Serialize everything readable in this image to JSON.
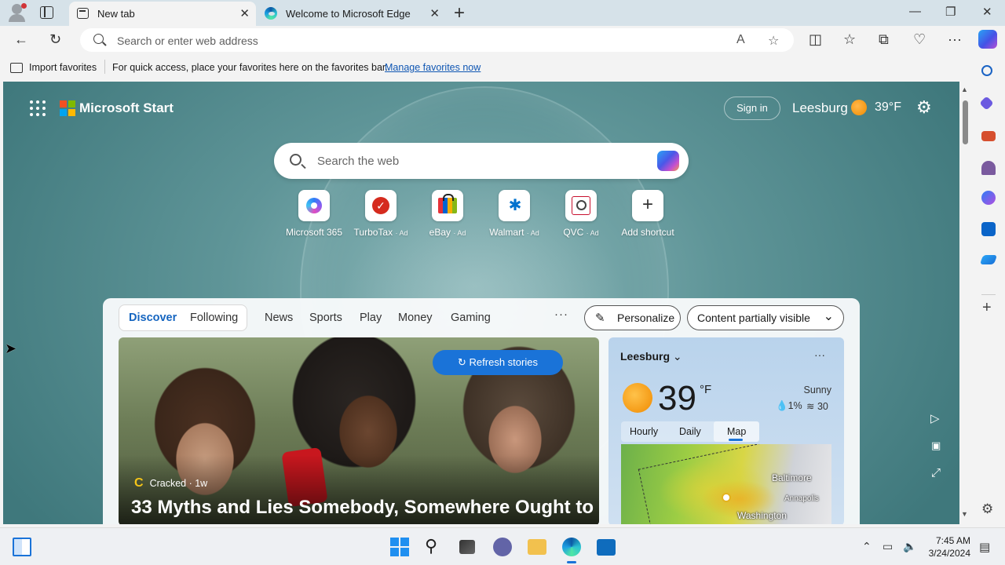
{
  "tabs": [
    {
      "label": "New tab",
      "active": true
    },
    {
      "label": "Welcome to Microsoft Edge",
      "active": false
    }
  ],
  "address": {
    "placeholder": "Search or enter web address"
  },
  "favorites": {
    "import_label": "Import favorites",
    "hint": "For quick access, place your favorites here on the favorites bar.",
    "manage_link": "Manage favorites now"
  },
  "header": {
    "brand": "Microsoft Start",
    "sign_in": "Sign in",
    "city": "Leesburg",
    "temp": "39°F"
  },
  "search": {
    "placeholder": "Search the web"
  },
  "shortcuts": [
    {
      "label": "Microsoft 365",
      "ad": ""
    },
    {
      "label": "TurboTax",
      "ad": "· Ad"
    },
    {
      "label": "eBay",
      "ad": "· Ad"
    },
    {
      "label": "Walmart",
      "ad": "· Ad"
    },
    {
      "label": "QVC",
      "ad": "· Ad"
    },
    {
      "label": "Add shortcut",
      "ad": ""
    }
  ],
  "feed_nav": {
    "tabs": [
      "Discover",
      "Following",
      "News",
      "Sports",
      "Play",
      "Money",
      "Gaming"
    ],
    "more": "···",
    "personalize": "Personalize",
    "visibility": "Content partially visible"
  },
  "hero": {
    "refresh": "Refresh stories",
    "source": "Cracked · 1w",
    "headline": "33 Myths and Lies Somebody, Somewhere Ought to"
  },
  "weather": {
    "city": "Leesburg",
    "more": "···",
    "temp": "39",
    "unit": "°F",
    "condition": "Sunny",
    "precip": "1%",
    "wind": "30",
    "tabs": [
      "Hourly",
      "Daily",
      "Map"
    ],
    "selected_tab": "Map",
    "map_labels": [
      "Baltimore",
      "Annapolis",
      "Washington"
    ]
  },
  "taskbar": {
    "time": "7:45 AM",
    "date": "3/24/2024"
  },
  "colors": {
    "accent": "#1a73d8",
    "link": "#0f56b3",
    "brand_bg": "#5f9598"
  }
}
